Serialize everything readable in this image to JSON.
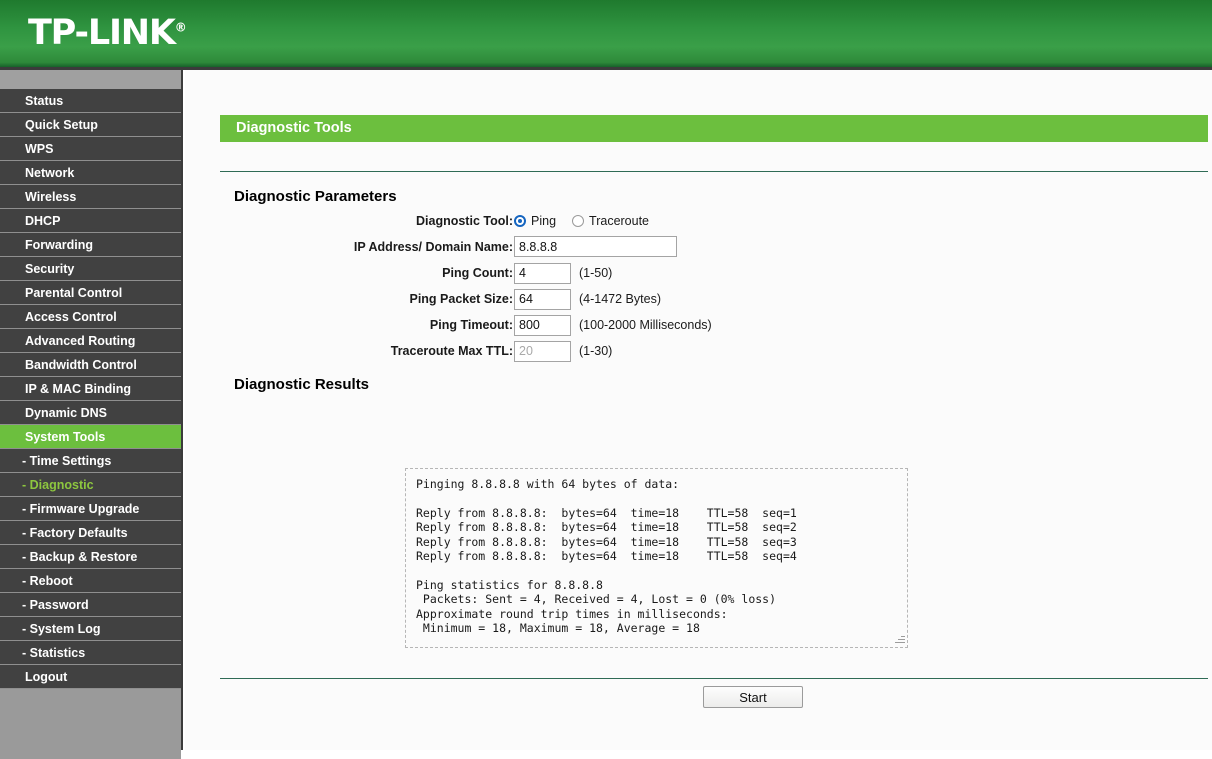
{
  "header": {
    "brand": "TP-LINK",
    "brand_mark": "®",
    "brand_color": "#2f9440"
  },
  "sidebar": {
    "items": [
      {
        "label": "Status",
        "type": "main",
        "state": "normal"
      },
      {
        "label": "Quick Setup",
        "type": "main",
        "state": "normal"
      },
      {
        "label": "WPS",
        "type": "main",
        "state": "normal"
      },
      {
        "label": "Network",
        "type": "main",
        "state": "normal"
      },
      {
        "label": "Wireless",
        "type": "main",
        "state": "normal"
      },
      {
        "label": "DHCP",
        "type": "main",
        "state": "normal"
      },
      {
        "label": "Forwarding",
        "type": "main",
        "state": "normal"
      },
      {
        "label": "Security",
        "type": "main",
        "state": "normal"
      },
      {
        "label": "Parental Control",
        "type": "main",
        "state": "normal"
      },
      {
        "label": "Access Control",
        "type": "main",
        "state": "normal"
      },
      {
        "label": "Advanced Routing",
        "type": "main",
        "state": "normal"
      },
      {
        "label": "Bandwidth Control",
        "type": "main",
        "state": "normal"
      },
      {
        "label": "IP & MAC Binding",
        "type": "main",
        "state": "normal"
      },
      {
        "label": "Dynamic DNS",
        "type": "main",
        "state": "normal"
      },
      {
        "label": "System Tools",
        "type": "main",
        "state": "active-parent"
      },
      {
        "label": "- Time Settings",
        "type": "sub",
        "state": "normal"
      },
      {
        "label": "- Diagnostic",
        "type": "sub",
        "state": "active-sub"
      },
      {
        "label": "- Firmware Upgrade",
        "type": "sub",
        "state": "normal"
      },
      {
        "label": "- Factory Defaults",
        "type": "sub",
        "state": "normal"
      },
      {
        "label": "- Backup & Restore",
        "type": "sub",
        "state": "normal"
      },
      {
        "label": "- Reboot",
        "type": "sub",
        "state": "normal"
      },
      {
        "label": "- Password",
        "type": "sub",
        "state": "normal"
      },
      {
        "label": "- System Log",
        "type": "sub",
        "state": "normal"
      },
      {
        "label": "- Statistics",
        "type": "sub",
        "state": "normal"
      },
      {
        "label": "Logout",
        "type": "main",
        "state": "normal"
      }
    ],
    "active_color": "#6cbf3e",
    "active_text_color": "#8dc63f"
  },
  "main": {
    "page_title": "Diagnostic Tools",
    "params_section_title": "Diagnostic Parameters",
    "results_section_title": "Diagnostic Results",
    "fields": {
      "diagnostic_tool_label": "Diagnostic Tool:",
      "ping_option_label": "Ping",
      "traceroute_option_label": "Traceroute",
      "ip_label": "IP Address/ Domain Name:",
      "ip_value": "8.8.8.8",
      "ping_count_label": "Ping Count:",
      "ping_count_value": "4",
      "ping_count_hint": "(1-50)",
      "packet_size_label": "Ping Packet Size:",
      "packet_size_value": "64",
      "packet_size_hint": "(4-1472 Bytes)",
      "timeout_label": "Ping Timeout:",
      "timeout_value": "800",
      "timeout_hint": "(100-2000 Milliseconds)",
      "ttl_label": "Traceroute Max TTL:",
      "ttl_value": "20",
      "ttl_hint": "(1-30)"
    },
    "results_text": "Pinging 8.8.8.8 with 64 bytes of data:\n\nReply from 8.8.8.8:  bytes=64  time=18    TTL=58  seq=1\nReply from 8.8.8.8:  bytes=64  time=18    TTL=58  seq=2\nReply from 8.8.8.8:  bytes=64  time=18    TTL=58  seq=3\nReply from 8.8.8.8:  bytes=64  time=18    TTL=58  seq=4\n\nPing statistics for 8.8.8.8\n Packets: Sent = 4, Received = 4, Lost = 0 (0% loss)\nApproximate round trip times in milliseconds:\n Minimum = 18, Maximum = 18, Average = 18",
    "start_button_label": "Start"
  }
}
